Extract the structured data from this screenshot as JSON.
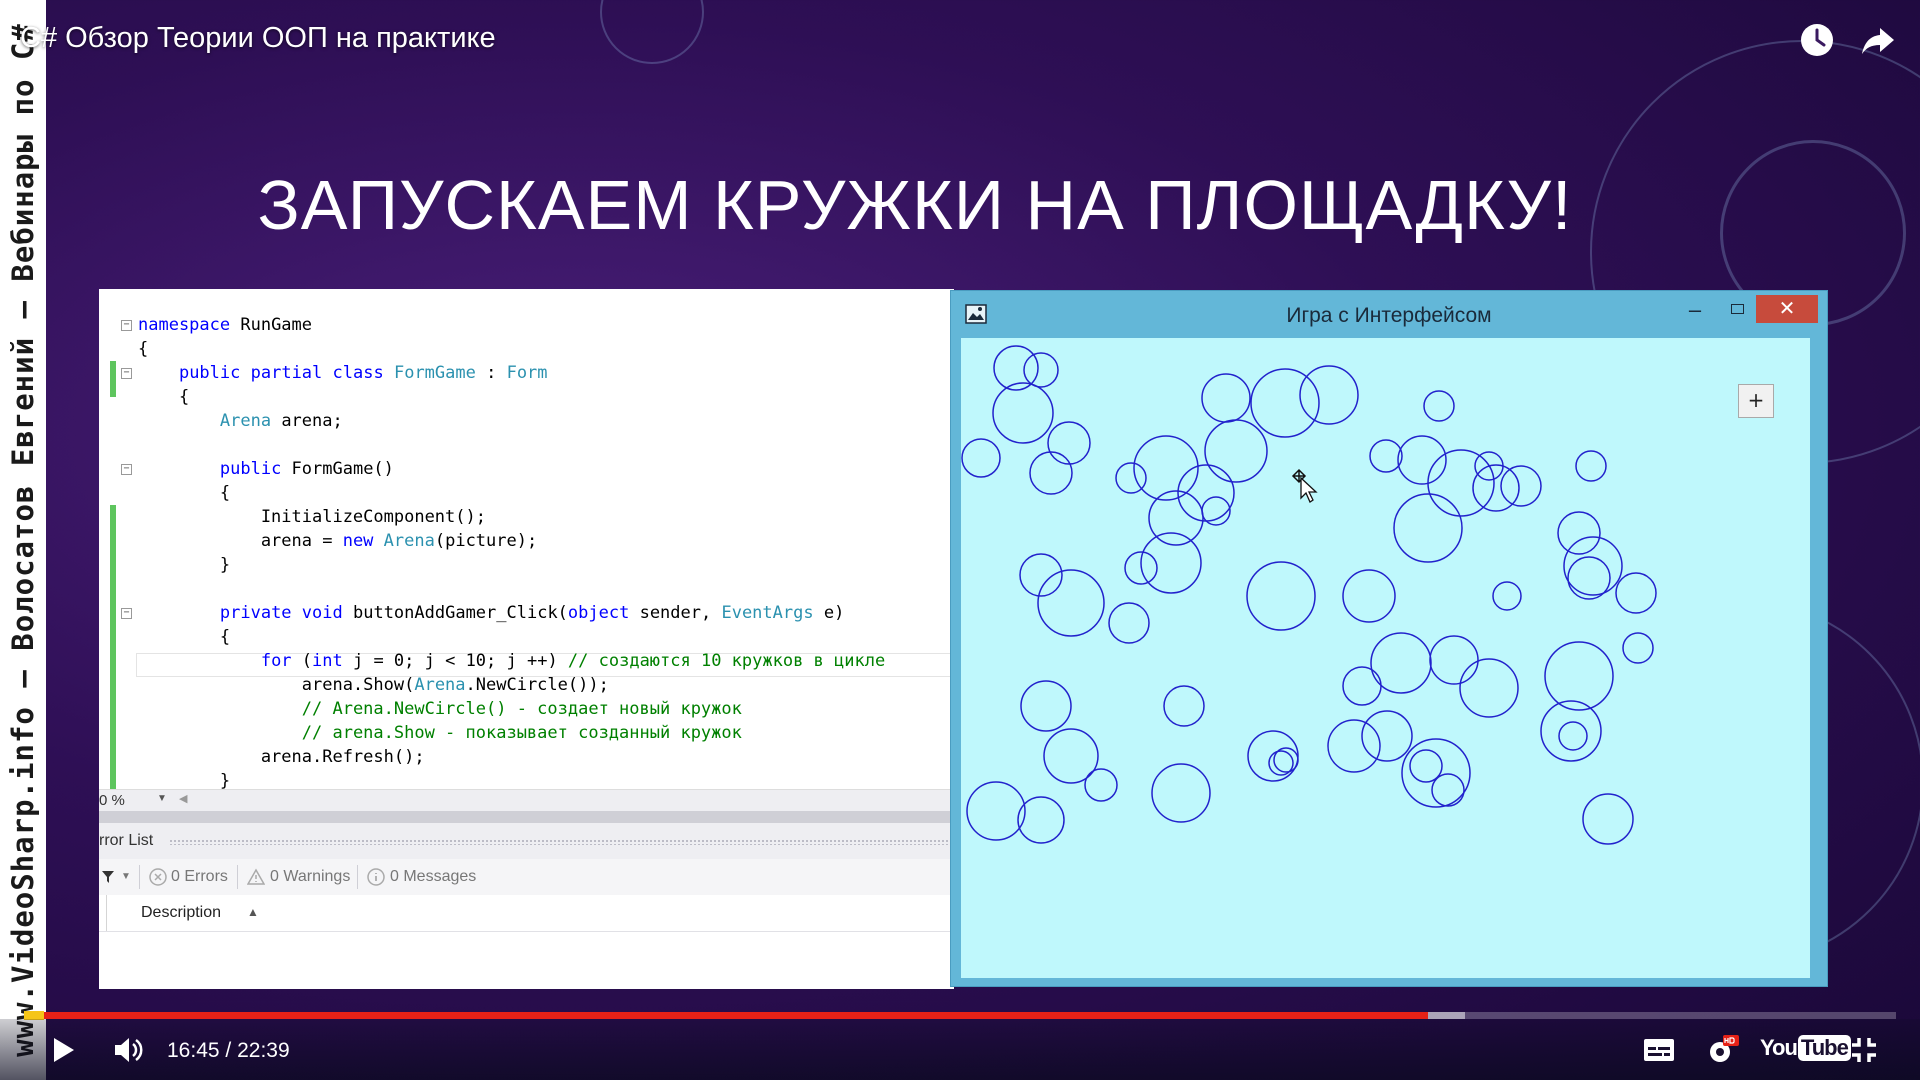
{
  "video": {
    "title": "C# Обзор Теории ООП на практике",
    "time_current": "16:45",
    "time_separator": "/",
    "time_total": "22:39",
    "progress_played": 0.75,
    "progress_loaded": 0.77
  },
  "watermark": "www.VideoSharp.info — Волосатов Евгений — Вебинары по C#",
  "slide": {
    "heading": "ЗАПУСКАЕМ КРУЖКИ НА ПЛОЩАДКУ!"
  },
  "ide": {
    "code_lines": [
      [
        {
          "t": "namespace",
          "c": "kw"
        },
        {
          "t": " RunGame",
          "c": ""
        }
      ],
      [
        {
          "t": "{",
          "c": ""
        }
      ],
      [
        {
          "t": "    ",
          "c": ""
        },
        {
          "t": "public",
          "c": "kw"
        },
        {
          "t": " ",
          "c": ""
        },
        {
          "t": "partial",
          "c": "kw"
        },
        {
          "t": " ",
          "c": ""
        },
        {
          "t": "class",
          "c": "kw"
        },
        {
          "t": " ",
          "c": ""
        },
        {
          "t": "FormGame",
          "c": "ty"
        },
        {
          "t": " : ",
          "c": ""
        },
        {
          "t": "Form",
          "c": "ty"
        }
      ],
      [
        {
          "t": "    {",
          "c": ""
        }
      ],
      [
        {
          "t": "        ",
          "c": ""
        },
        {
          "t": "Arena",
          "c": "ty"
        },
        {
          "t": " arena;",
          "c": ""
        }
      ],
      [
        {
          "t": "",
          "c": ""
        }
      ],
      [
        {
          "t": "        ",
          "c": ""
        },
        {
          "t": "public",
          "c": "kw"
        },
        {
          "t": " FormGame()",
          "c": ""
        }
      ],
      [
        {
          "t": "        {",
          "c": ""
        }
      ],
      [
        {
          "t": "            InitializeComponent();",
          "c": ""
        }
      ],
      [
        {
          "t": "            arena = ",
          "c": ""
        },
        {
          "t": "new",
          "c": "kw"
        },
        {
          "t": " ",
          "c": ""
        },
        {
          "t": "Arena",
          "c": "ty"
        },
        {
          "t": "(picture);",
          "c": ""
        }
      ],
      [
        {
          "t": "        }",
          "c": ""
        }
      ],
      [
        {
          "t": "",
          "c": ""
        }
      ],
      [
        {
          "t": "        ",
          "c": ""
        },
        {
          "t": "private",
          "c": "kw"
        },
        {
          "t": " ",
          "c": ""
        },
        {
          "t": "void",
          "c": "kw"
        },
        {
          "t": " buttonAddGamer_Click(",
          "c": ""
        },
        {
          "t": "object",
          "c": "kw"
        },
        {
          "t": " sender, ",
          "c": ""
        },
        {
          "t": "EventArgs",
          "c": "ty"
        },
        {
          "t": " e)",
          "c": ""
        }
      ],
      [
        {
          "t": "        {",
          "c": ""
        }
      ],
      [
        {
          "t": "            ",
          "c": ""
        },
        {
          "t": "for",
          "c": "kw"
        },
        {
          "t": " (",
          "c": ""
        },
        {
          "t": "int",
          "c": "kw"
        },
        {
          "t": " j = 0; j < 10; j ++) ",
          "c": ""
        },
        {
          "t": "// создаются 10 кружков в цикле",
          "c": "cm"
        }
      ],
      [
        {
          "t": "                arena.Show(",
          "c": ""
        },
        {
          "t": "Arena",
          "c": "ty"
        },
        {
          "t": ".NewCircle());",
          "c": ""
        }
      ],
      [
        {
          "t": "                ",
          "c": ""
        },
        {
          "t": "// Arena.NewCircle() - создает новый кружок",
          "c": "cm"
        }
      ],
      [
        {
          "t": "                ",
          "c": ""
        },
        {
          "t": "// arena.Show - показывает созданный кружок",
          "c": "cm"
        }
      ],
      [
        {
          "t": "            arena.Refresh();",
          "c": ""
        }
      ],
      [
        {
          "t": "        }",
          "c": ""
        }
      ]
    ],
    "zoom": "0 %",
    "error_list": {
      "title": "rror List",
      "errors": "0 Errors",
      "warnings": "0 Warnings",
      "messages": "0 Messages",
      "column_description": "Description"
    }
  },
  "game_window": {
    "title": "Игра с Интерфейсом",
    "add_button_label": "+",
    "circle_stroke": "#2222cc",
    "client_bg": "#bff8fc",
    "circles": [
      [
        55,
        30,
        22
      ],
      [
        80,
        32,
        17
      ],
      [
        62,
        75,
        30
      ],
      [
        20,
        120,
        19
      ],
      [
        108,
        105,
        21
      ],
      [
        90,
        135,
        21
      ],
      [
        170,
        140,
        15
      ],
      [
        205,
        130,
        32
      ],
      [
        245,
        155,
        28
      ],
      [
        255,
        173,
        14
      ],
      [
        215,
        180,
        27
      ],
      [
        210,
        225,
        30
      ],
      [
        180,
        230,
        16
      ],
      [
        265,
        60,
        24
      ],
      [
        324,
        65,
        34
      ],
      [
        368,
        57,
        29
      ],
      [
        275,
        113,
        31
      ],
      [
        478,
        68,
        15
      ],
      [
        425,
        118,
        16
      ],
      [
        461,
        122,
        24
      ],
      [
        500,
        145,
        33
      ],
      [
        528,
        128,
        14
      ],
      [
        535,
        150,
        23
      ],
      [
        560,
        148,
        20
      ],
      [
        630,
        128,
        15
      ],
      [
        467,
        190,
        34
      ],
      [
        618,
        195,
        21
      ],
      [
        632,
        228,
        29
      ],
      [
        628,
        240,
        21
      ],
      [
        675,
        255,
        20
      ],
      [
        80,
        237,
        21
      ],
      [
        110,
        265,
        33
      ],
      [
        168,
        285,
        20
      ],
      [
        320,
        258,
        34
      ],
      [
        408,
        258,
        26
      ],
      [
        546,
        258,
        14
      ],
      [
        440,
        325,
        30
      ],
      [
        493,
        322,
        24
      ],
      [
        401,
        348,
        19
      ],
      [
        528,
        350,
        29
      ],
      [
        618,
        338,
        34
      ],
      [
        677,
        310,
        15
      ],
      [
        85,
        368,
        25
      ],
      [
        223,
        368,
        20
      ],
      [
        110,
        418,
        27
      ],
      [
        140,
        447,
        16
      ],
      [
        35,
        473,
        29
      ],
      [
        80,
        482,
        23
      ],
      [
        220,
        455,
        29
      ],
      [
        312,
        418,
        25
      ],
      [
        320,
        425,
        12
      ],
      [
        325,
        422,
        12
      ],
      [
        393,
        408,
        26
      ],
      [
        426,
        398,
        25
      ],
      [
        475,
        435,
        34
      ],
      [
        465,
        428,
        16
      ],
      [
        487,
        452,
        16
      ],
      [
        610,
        393,
        30
      ],
      [
        612,
        398,
        14
      ],
      [
        647,
        481,
        25
      ]
    ]
  }
}
